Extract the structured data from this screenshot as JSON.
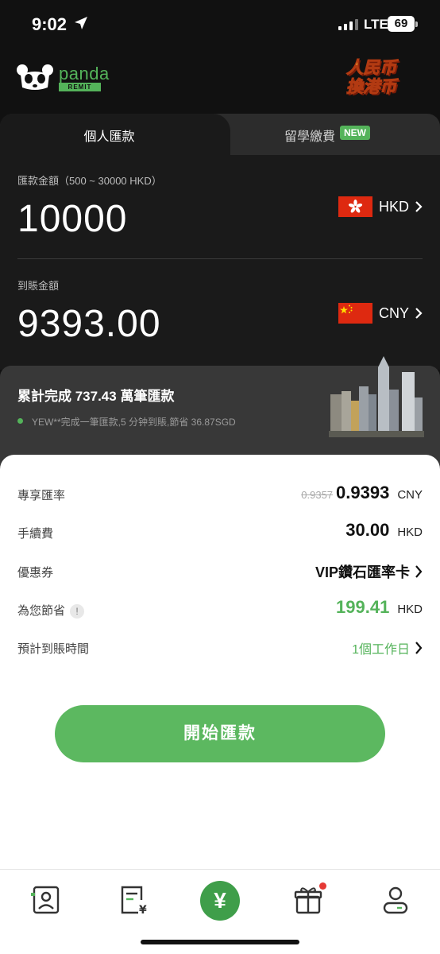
{
  "status_bar": {
    "time": "9:02",
    "network": "LTE",
    "battery": "69"
  },
  "header": {
    "logo_text": "panda",
    "logo_badge": "REMIT",
    "promo_line1": "人民币",
    "promo_line2": "換港币"
  },
  "tabs": [
    {
      "label": "個人匯款",
      "active": true
    },
    {
      "label": "留學繳費",
      "badge": "NEW",
      "active": false
    }
  ],
  "send": {
    "label": "匯款金額（500 ~ 30000 HKD）",
    "amount": "10000",
    "currency": "HKD"
  },
  "receive": {
    "label": "到賬金額",
    "amount": "9393.00",
    "currency": "CNY"
  },
  "stats": {
    "title": "累計完成 737.43 萬筆匯款",
    "ticker": "YEW**完成一筆匯款,5 分钟到賬,節省 36.87SGD"
  },
  "details": {
    "rate": {
      "label": "專享匯率",
      "old": "0.9357",
      "value": "0.9393",
      "unit": "CNY"
    },
    "fee": {
      "label": "手續費",
      "value": "30.00",
      "unit": "HKD"
    },
    "coupon": {
      "label": "優惠券",
      "value": "VIP鑽石匯率卡"
    },
    "savings": {
      "label": "為您節省",
      "info": "!",
      "value": "199.41",
      "unit": "HKD"
    },
    "eta": {
      "label": "預計到賬時間",
      "value": "1個工作日"
    }
  },
  "cta": {
    "label": "開始匯款"
  },
  "nav": {
    "center_symbol": "¥"
  },
  "colors": {
    "brand": "#54b35a",
    "dark_bg": "#111111",
    "accent_red": "#e53935"
  }
}
